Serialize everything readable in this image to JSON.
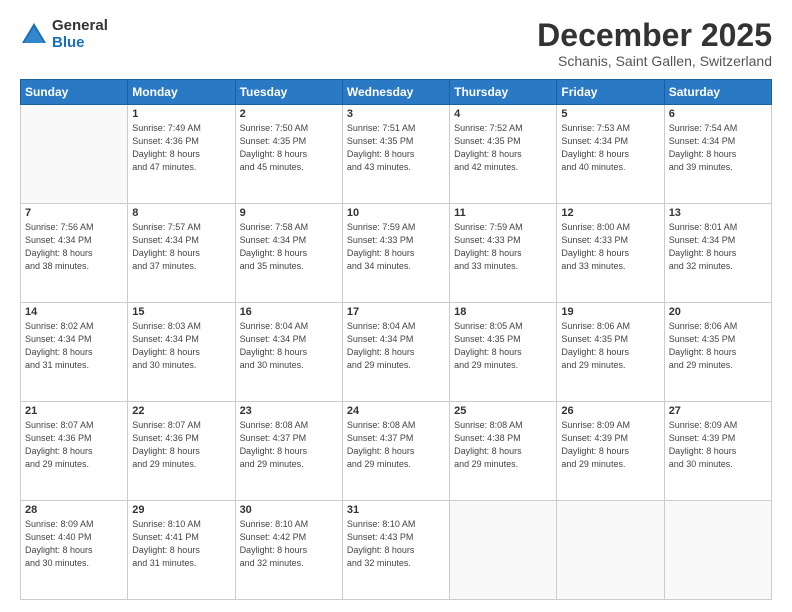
{
  "logo": {
    "general": "General",
    "blue": "Blue"
  },
  "header": {
    "title": "December 2025",
    "subtitle": "Schanis, Saint Gallen, Switzerland"
  },
  "days_of_week": [
    "Sunday",
    "Monday",
    "Tuesday",
    "Wednesday",
    "Thursday",
    "Friday",
    "Saturday"
  ],
  "weeks": [
    [
      {
        "day": "",
        "info": ""
      },
      {
        "day": "1",
        "info": "Sunrise: 7:49 AM\nSunset: 4:36 PM\nDaylight: 8 hours\nand 47 minutes."
      },
      {
        "day": "2",
        "info": "Sunrise: 7:50 AM\nSunset: 4:35 PM\nDaylight: 8 hours\nand 45 minutes."
      },
      {
        "day": "3",
        "info": "Sunrise: 7:51 AM\nSunset: 4:35 PM\nDaylight: 8 hours\nand 43 minutes."
      },
      {
        "day": "4",
        "info": "Sunrise: 7:52 AM\nSunset: 4:35 PM\nDaylight: 8 hours\nand 42 minutes."
      },
      {
        "day": "5",
        "info": "Sunrise: 7:53 AM\nSunset: 4:34 PM\nDaylight: 8 hours\nand 40 minutes."
      },
      {
        "day": "6",
        "info": "Sunrise: 7:54 AM\nSunset: 4:34 PM\nDaylight: 8 hours\nand 39 minutes."
      }
    ],
    [
      {
        "day": "7",
        "info": "Sunrise: 7:56 AM\nSunset: 4:34 PM\nDaylight: 8 hours\nand 38 minutes."
      },
      {
        "day": "8",
        "info": "Sunrise: 7:57 AM\nSunset: 4:34 PM\nDaylight: 8 hours\nand 37 minutes."
      },
      {
        "day": "9",
        "info": "Sunrise: 7:58 AM\nSunset: 4:34 PM\nDaylight: 8 hours\nand 35 minutes."
      },
      {
        "day": "10",
        "info": "Sunrise: 7:59 AM\nSunset: 4:33 PM\nDaylight: 8 hours\nand 34 minutes."
      },
      {
        "day": "11",
        "info": "Sunrise: 7:59 AM\nSunset: 4:33 PM\nDaylight: 8 hours\nand 33 minutes."
      },
      {
        "day": "12",
        "info": "Sunrise: 8:00 AM\nSunset: 4:33 PM\nDaylight: 8 hours\nand 33 minutes."
      },
      {
        "day": "13",
        "info": "Sunrise: 8:01 AM\nSunset: 4:34 PM\nDaylight: 8 hours\nand 32 minutes."
      }
    ],
    [
      {
        "day": "14",
        "info": "Sunrise: 8:02 AM\nSunset: 4:34 PM\nDaylight: 8 hours\nand 31 minutes."
      },
      {
        "day": "15",
        "info": "Sunrise: 8:03 AM\nSunset: 4:34 PM\nDaylight: 8 hours\nand 30 minutes."
      },
      {
        "day": "16",
        "info": "Sunrise: 8:04 AM\nSunset: 4:34 PM\nDaylight: 8 hours\nand 30 minutes."
      },
      {
        "day": "17",
        "info": "Sunrise: 8:04 AM\nSunset: 4:34 PM\nDaylight: 8 hours\nand 29 minutes."
      },
      {
        "day": "18",
        "info": "Sunrise: 8:05 AM\nSunset: 4:35 PM\nDaylight: 8 hours\nand 29 minutes."
      },
      {
        "day": "19",
        "info": "Sunrise: 8:06 AM\nSunset: 4:35 PM\nDaylight: 8 hours\nand 29 minutes."
      },
      {
        "day": "20",
        "info": "Sunrise: 8:06 AM\nSunset: 4:35 PM\nDaylight: 8 hours\nand 29 minutes."
      }
    ],
    [
      {
        "day": "21",
        "info": "Sunrise: 8:07 AM\nSunset: 4:36 PM\nDaylight: 8 hours\nand 29 minutes."
      },
      {
        "day": "22",
        "info": "Sunrise: 8:07 AM\nSunset: 4:36 PM\nDaylight: 8 hours\nand 29 minutes."
      },
      {
        "day": "23",
        "info": "Sunrise: 8:08 AM\nSunset: 4:37 PM\nDaylight: 8 hours\nand 29 minutes."
      },
      {
        "day": "24",
        "info": "Sunrise: 8:08 AM\nSunset: 4:37 PM\nDaylight: 8 hours\nand 29 minutes."
      },
      {
        "day": "25",
        "info": "Sunrise: 8:08 AM\nSunset: 4:38 PM\nDaylight: 8 hours\nand 29 minutes."
      },
      {
        "day": "26",
        "info": "Sunrise: 8:09 AM\nSunset: 4:39 PM\nDaylight: 8 hours\nand 29 minutes."
      },
      {
        "day": "27",
        "info": "Sunrise: 8:09 AM\nSunset: 4:39 PM\nDaylight: 8 hours\nand 30 minutes."
      }
    ],
    [
      {
        "day": "28",
        "info": "Sunrise: 8:09 AM\nSunset: 4:40 PM\nDaylight: 8 hours\nand 30 minutes."
      },
      {
        "day": "29",
        "info": "Sunrise: 8:10 AM\nSunset: 4:41 PM\nDaylight: 8 hours\nand 31 minutes."
      },
      {
        "day": "30",
        "info": "Sunrise: 8:10 AM\nSunset: 4:42 PM\nDaylight: 8 hours\nand 32 minutes."
      },
      {
        "day": "31",
        "info": "Sunrise: 8:10 AM\nSunset: 4:43 PM\nDaylight: 8 hours\nand 32 minutes."
      },
      {
        "day": "",
        "info": ""
      },
      {
        "day": "",
        "info": ""
      },
      {
        "day": "",
        "info": ""
      }
    ]
  ]
}
